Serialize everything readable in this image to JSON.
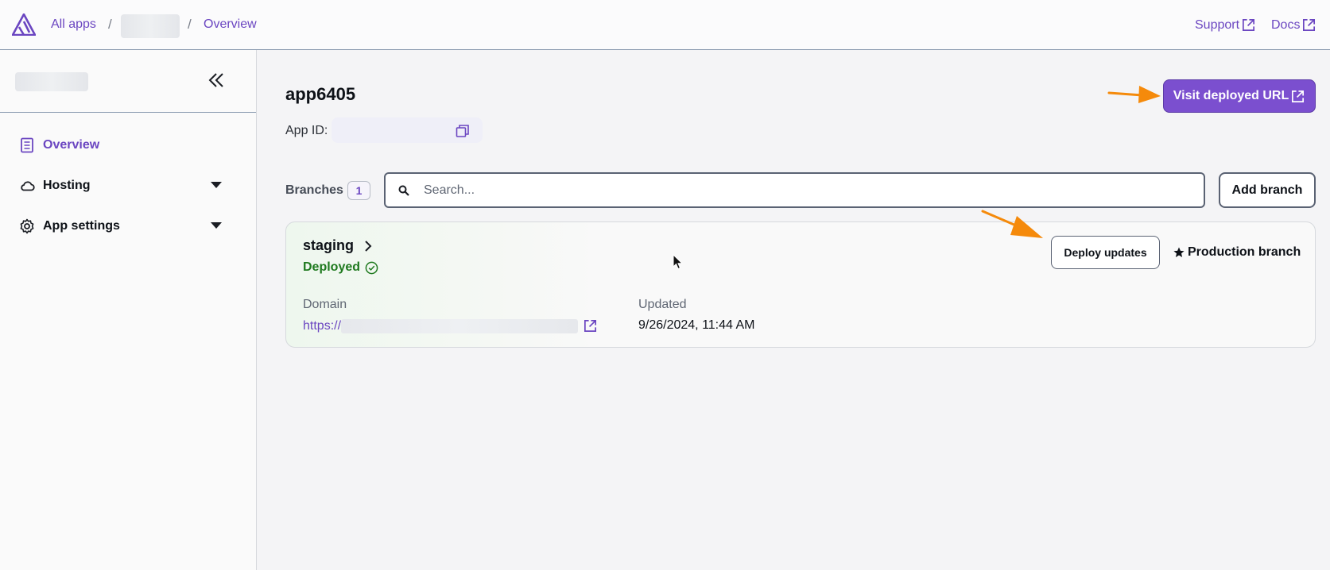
{
  "topbar": {
    "logo_icon": "amplify-logo-icon",
    "breadcrumb": {
      "all_apps": "All apps",
      "separator": "/",
      "current": "Overview"
    },
    "links": {
      "support": "Support",
      "docs": "Docs"
    }
  },
  "sidebar": {
    "collapse_icon": "double-chevron-left-icon",
    "items": [
      {
        "label": "Overview",
        "icon": "document-icon",
        "active": true
      },
      {
        "label": "Hosting",
        "icon": "cloud-icon",
        "expandable": true
      },
      {
        "label": "App settings",
        "icon": "gear-icon",
        "expandable": true
      }
    ]
  },
  "main": {
    "app_name": "app6405",
    "app_id_label": "App ID:",
    "visit_button": "Visit deployed URL",
    "branches": {
      "label": "Branches",
      "count": "1",
      "search_placeholder": "Search...",
      "add_button": "Add branch"
    },
    "branch_card": {
      "name": "staging",
      "status": "Deployed",
      "domain_label": "Domain",
      "domain_prefix": "https://",
      "updated_label": "Updated",
      "updated_value": "9/26/2024, 11:44 AM",
      "deploy_button": "Deploy updates",
      "production_label": "Production branch"
    }
  },
  "colors": {
    "accent": "#6b46c1",
    "button_primary": "#7b4fcf",
    "status_success": "#1f7a1f",
    "annotation_arrow": "#f58a0b"
  }
}
